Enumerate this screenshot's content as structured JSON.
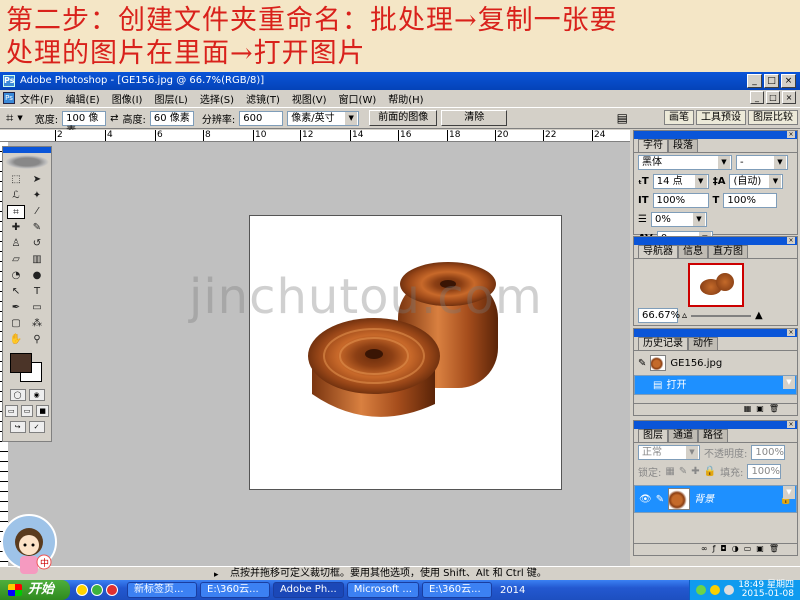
{
  "slide": {
    "caption_line1": "第二步：创建文件夹重命名：批处理→复制一张要",
    "caption_line2": "处理的图片在里面→打开图片"
  },
  "window": {
    "title": "Adobe Photoshop - [GE156.jpg @ 66.7%(RGB/8)]",
    "minimize": "_",
    "maximize": "□",
    "close": "×"
  },
  "menu": {
    "items": [
      "文件(F)",
      "编辑(E)",
      "图像(I)",
      "图层(L)",
      "选择(S)",
      "滤镜(T)",
      "视图(V)",
      "窗口(W)",
      "帮助(H)"
    ]
  },
  "options": {
    "width_label": "宽度:",
    "width_value": "100 像素",
    "height_label": "高度:",
    "height_value": "60 像素",
    "resolution_label": "分辨率:",
    "resolution_value": "600",
    "unit_value": "像素/英寸",
    "front_image_button": "前面的图像",
    "clear_button": "清除",
    "well_tabs": [
      "画笔",
      "工具预设",
      "图层比较"
    ]
  },
  "ruler_top": [
    "2",
    "4",
    "6",
    "8",
    "10",
    "12",
    "14",
    "16",
    "18",
    "20",
    "22",
    "24"
  ],
  "watermark": "jinchutou.com",
  "character_panel": {
    "tabs": [
      "字符",
      "段落"
    ],
    "font_family": "黑体",
    "font_style": "-",
    "size": "14 点",
    "leading": "(自动)",
    "vscale": "100%",
    "hscale": "100%",
    "tracking": "0%",
    "kerning": "0"
  },
  "navigator_panel": {
    "tabs": [
      "导航器",
      "信息",
      "直方图"
    ],
    "zoom": "66.67%"
  },
  "history_panel": {
    "tabs": [
      "历史记录",
      "动作"
    ],
    "snapshot": "GE156.jpg",
    "step": "打开"
  },
  "layers_panel": {
    "tabs": [
      "图层",
      "通道",
      "路径"
    ],
    "blend_mode": "正常",
    "opacity_label": "不透明度:",
    "opacity_value": "100%",
    "lock_label": "锁定:",
    "fill_label": "填充:",
    "fill_value": "100%",
    "layer_name": "背景"
  },
  "status": {
    "text": "点按并拖移可定义裁切框。要用其他选项，使用 Shift、Alt 和 Ctrl 键。"
  },
  "taskbar": {
    "start": "开始",
    "tasks": [
      "新标签页...",
      "E:\\360云...",
      "Adobe Ph...",
      "Microsoft ...",
      "E:\\360云..."
    ],
    "year_label": "2014",
    "time": "18:49 星期四",
    "date": "2015-01-08"
  },
  "colors": {
    "caption": "#d9211b",
    "title_bar": "#0a55d8",
    "selection": "#1e90ff",
    "foreground_color": "#4b3428",
    "copper": "#b85a20"
  }
}
